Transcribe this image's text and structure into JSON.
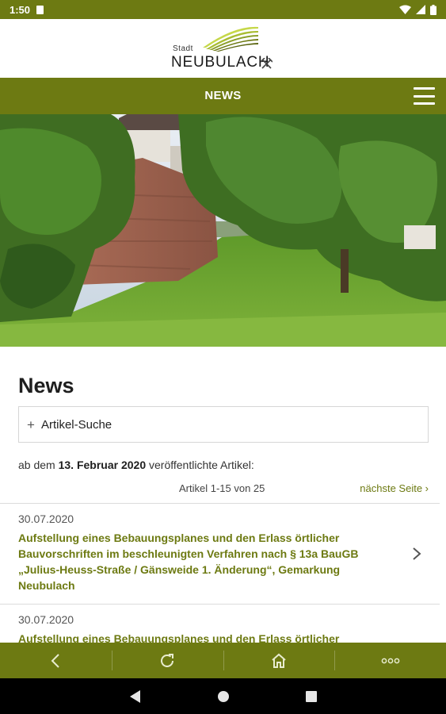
{
  "status_bar": {
    "time": "1:50"
  },
  "site": {
    "logo_small": "Stadt",
    "logo_name": "NEUBULACH"
  },
  "nav": {
    "title": "NEWS"
  },
  "main": {
    "heading": "News",
    "search_toggle_icon": "+",
    "search_label": "Artikel-Suche",
    "filter_prefix": "ab dem ",
    "filter_date": "13. Februar 2020",
    "filter_suffix": " veröffentlichte Artikel:",
    "pagination_info": "Artikel 1-15 von 25",
    "next_page": "nächste Seite ›"
  },
  "articles": [
    {
      "date": "30.07.2020",
      "title": "Aufstellung eines Bebauungsplanes und den Erlass örtlicher Bauvorschriften im beschleunigten Verfahren nach § 13a BauGB „Julius-Heuss-Straße / Gänsweide 1. Änderung“, Gemarkung Neubulach"
    },
    {
      "date": "30.07.2020",
      "title": "Aufstellung eines Bebauungsplanes und den Erlass örtlicher"
    }
  ],
  "icons": {
    "nav_menu": "hamburger-icon",
    "back": "back-arrow-icon",
    "reload": "reload-icon",
    "home": "home-icon",
    "more": "more-dots-icon",
    "article_open": "chevron-right-icon"
  },
  "colors": {
    "brand_green": "#6d7a12",
    "link_green": "#6d7a12",
    "system_bar": "#000000"
  }
}
